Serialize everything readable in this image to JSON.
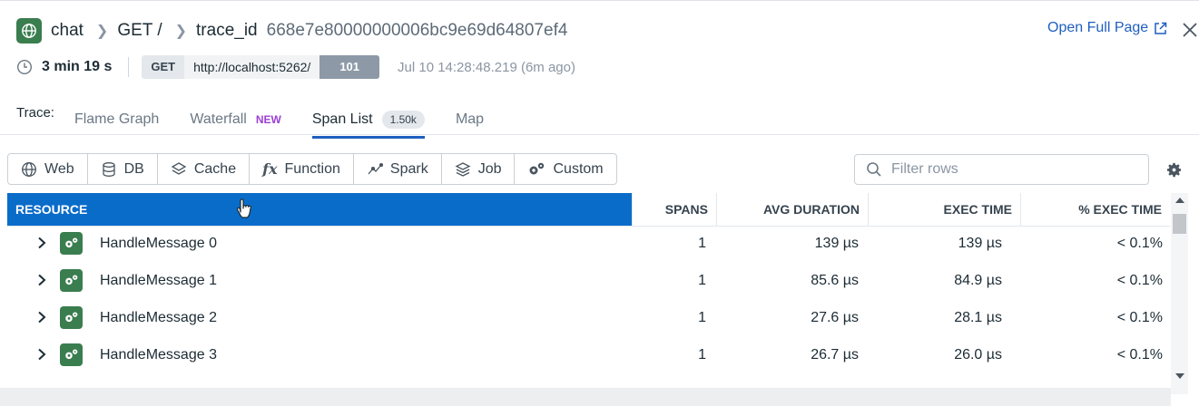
{
  "header": {
    "service": "chat",
    "resource": "GET /",
    "trace_label": "trace_id",
    "trace_id": "668e7e80000000006bc9e69d64807ef4",
    "open_full_page": "Open Full Page"
  },
  "meta": {
    "duration": "3 min 19 s",
    "method": "GET",
    "url": "http://localhost:5262/",
    "status": "101",
    "timestamp": "Jul 10 14:28:48.219 (6m ago)"
  },
  "tabs": {
    "label": "Trace:",
    "items": [
      {
        "label": "Flame Graph"
      },
      {
        "label": "Waterfall",
        "tag": "NEW"
      },
      {
        "label": "Span List",
        "count": "1.50k",
        "active": true
      },
      {
        "label": "Map"
      }
    ]
  },
  "filters": [
    "Web",
    "DB",
    "Cache",
    "Function",
    "Spark",
    "Job",
    "Custom"
  ],
  "search": {
    "placeholder": "Filter rows"
  },
  "table": {
    "columns": [
      "RESOURCE",
      "SPANS",
      "AVG DURATION",
      "EXEC TIME",
      "% EXEC TIME"
    ],
    "rows": [
      {
        "name": "HandleMessage 0",
        "spans": "1",
        "avg": "139 µs",
        "exec": "139 µs",
        "pct": "< 0.1%"
      },
      {
        "name": "HandleMessage 1",
        "spans": "1",
        "avg": "85.6 µs",
        "exec": "84.9 µs",
        "pct": "< 0.1%"
      },
      {
        "name": "HandleMessage 2",
        "spans": "1",
        "avg": "27.6 µs",
        "exec": "28.1 µs",
        "pct": "< 0.1%"
      },
      {
        "name": "HandleMessage 3",
        "spans": "1",
        "avg": "26.7 µs",
        "exec": "26.0 µs",
        "pct": "< 0.1%"
      }
    ]
  },
  "colors": {
    "accent": "#1f5fbf",
    "header_selected": "#0a6cc9",
    "service_icon": "#3a7d4f",
    "new_tag": "#9b3fd6"
  }
}
